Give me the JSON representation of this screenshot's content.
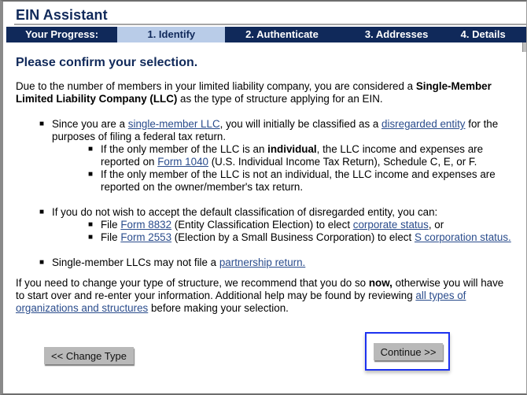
{
  "app": {
    "title": "EIN Assistant"
  },
  "progress": {
    "label": "Your Progress:",
    "steps": [
      {
        "label": "1. Identify",
        "current": true
      },
      {
        "label": "2. Authenticate",
        "current": false
      },
      {
        "label": "3. Addresses",
        "current": false
      },
      {
        "label": "4. Details",
        "current": false
      }
    ]
  },
  "heading": "Please confirm your selection.",
  "intro": {
    "pre": "Due to the number of members in your limited liability company, you are considered a ",
    "bold": "Single-Member Limited Liability Company (LLC)",
    "post": " as the type of structure applying for an EIN."
  },
  "bullet1": {
    "pre": "Since you are a ",
    "link1": "single-member LLC",
    "mid": ", you will initially be classified as a ",
    "link2": "disregarded entity",
    "post": " for the purposes of filing a federal tax return.",
    "sub1": {
      "pre": "If the only member of the LLC is an ",
      "bold": "individual",
      "mid": ", the LLC income and expenses are reported on ",
      "link": "Form 1040",
      "post": " (U.S. Individual Income Tax Return), Schedule C, E, or F."
    },
    "sub2": "If the only member of the LLC is not an individual, the LLC income and expenses are reported on the owner/member's tax return."
  },
  "bullet2": {
    "text": "If you do not wish to accept the default classification of disregarded entity, you can:",
    "sub1": {
      "pre": "File ",
      "link1": "Form 8832",
      "mid": " (Entity Classification Election) to elect ",
      "link2": "corporate status",
      "post": ", or"
    },
    "sub2": {
      "pre": "File ",
      "link1": "Form 2553",
      "mid": " (Election by a Small Business Corporation) to elect ",
      "link2": "S corporation status."
    }
  },
  "bullet3": {
    "pre": "Single-member LLCs may not file a ",
    "link": "partnership return."
  },
  "closing": {
    "pre": "If you need to change your type of structure, we recommend that you do so ",
    "bold": "now,",
    "mid": " otherwise you will have to start over and re-enter your information.  Additional help may be found by reviewing ",
    "link": "all types of organizations and structures",
    "post": " before making your selection."
  },
  "buttons": {
    "change_type": "<< Change Type",
    "continue": "Continue >>"
  },
  "colors": {
    "brand_navy": "#10295a",
    "current_step_bg": "#b9cce8",
    "link": "#2a4c8c",
    "focus_ring": "#1d32f0",
    "button_bg": "#b9b9b9"
  }
}
